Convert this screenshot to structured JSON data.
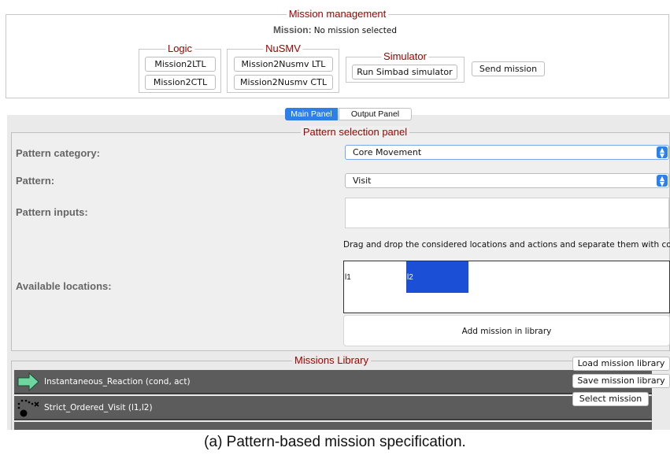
{
  "mission_management": {
    "legend": "Mission management",
    "mission_label": "Mission:",
    "mission_value": "No mission selected"
  },
  "logic": {
    "legend": "Logic",
    "buttons": [
      "Mission2LTL",
      "Mission2CTL"
    ]
  },
  "nusmv": {
    "legend": "NuSMV",
    "buttons": [
      "Mission2Nusmv LTL",
      "Mission2Nusmv CTL"
    ]
  },
  "simulator": {
    "legend": "Simulator",
    "button": "Run Simbad simulator"
  },
  "send_mission_label": "Send mission",
  "tabs": {
    "main": "Main Panel",
    "output": "Output Panel",
    "active_color": "#2f7fe8"
  },
  "pattern_panel": {
    "legend": "Pattern selection panel",
    "category_label": "Pattern category:",
    "category_value": "Core Movement",
    "pattern_label": "Pattern:",
    "pattern_value": "Visit",
    "inputs_label": "Pattern inputs:",
    "inputs_value": "",
    "hint": "Drag and drop the considered locations and actions and separate them with comma",
    "locations_label": "Available locations:",
    "locations": [
      "l1",
      "l2"
    ],
    "selected_location_color": "#1a4fd6",
    "add_button": "Add mission in library"
  },
  "library": {
    "legend": "Missions Library",
    "items": [
      {
        "label": "Instantaneous_Reaction (cond, act)",
        "icon": "green-arrow-icon"
      },
      {
        "label": "Strict_Ordered_Visit (l1,l2)",
        "icon": "dotted-path-icon"
      }
    ],
    "load_button": "Load mission library",
    "save_button": "Save mission library",
    "select_button": "Select mission"
  },
  "caption": "(a) Pattern-based mission specification."
}
